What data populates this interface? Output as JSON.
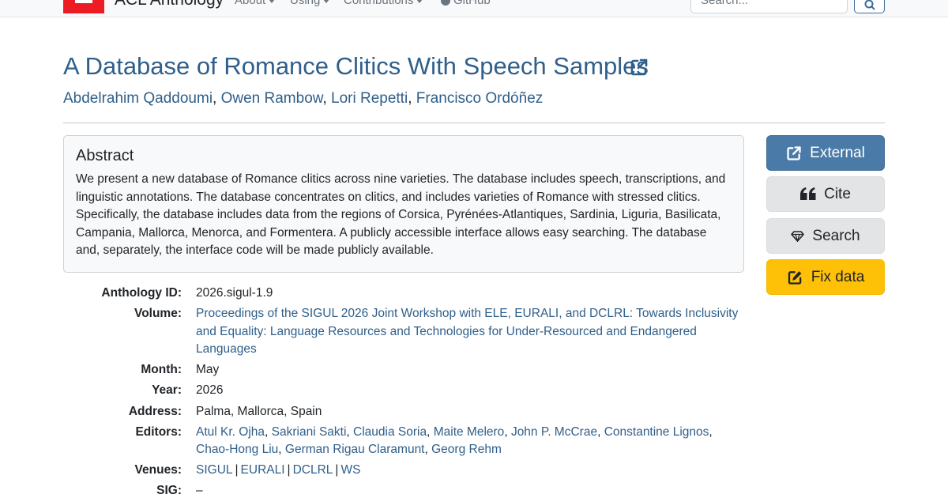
{
  "navbar": {
    "brand": "ACL Anthology",
    "links": [
      {
        "label": "About"
      },
      {
        "label": "Using"
      },
      {
        "label": "Contributions"
      },
      {
        "label": "GitHub"
      }
    ],
    "search_placeholder": "Search..."
  },
  "paper": {
    "title": "A Database of Romance Clitics With Speech Samples",
    "authors": [
      "Abdelrahim Qaddoumi",
      "Owen Rambow",
      "Lori Repetti",
      "Francisco Ordóñez"
    ],
    "abstract_heading": "Abstract",
    "abstract_text": "We present a new database of Romance clitics across nine varieties. The database includes speech, transcriptions, and linguistic annotations. The database concentrates on clitics, and includes varieties of Romance with stressed clitics. Specifically, the database includes data from the regions of Corsica, Pyrénées-Atlantiques, Sardinia, Liguria, Basilicata, Campania, Mallorca, Menorca, and Formentera. A publicly accessible interface allows easy searching. The database and, separately, the interface code will be made publicly available."
  },
  "details": {
    "anthology_id_label": "Anthology ID:",
    "anthology_id": "2026.sigul-1.9",
    "volume_label": "Volume:",
    "volume": "Proceedings of the SIGUL 2026 Joint Workshop with ELE, EURALI, and DCLRL: Towards Inclusivity and Equality: Language Resources and Technologies for Under-Resourced and Endangered Languages",
    "month_label": "Month:",
    "month": "May",
    "year_label": "Year:",
    "year": "2026",
    "address_label": "Address:",
    "address": "Palma, Mallorca, Spain",
    "editors_label": "Editors:",
    "editors": [
      "Atul Kr. Ojha",
      "Sakriani Sakti",
      "Claudia Soria",
      "Maite Melero",
      "John P. McCrae",
      "Constantine Lignos",
      "Chao-Hong Liu",
      "German Rigau Claramunt",
      "Georg Rehm"
    ],
    "venues_label": "Venues:",
    "venues": [
      "SIGUL",
      "EURALI",
      "DCLRL",
      "WS"
    ],
    "sig_label": "SIG:",
    "sig": "–"
  },
  "sidebar": {
    "external_label": "External",
    "cite_label": "Cite",
    "search_label": "Search",
    "fix_label": "Fix data"
  },
  "colors": {
    "link": "#2f5f8a",
    "primary_button": "#4a7aa7",
    "warning_button": "#ffc107",
    "logo_red": "#ed1c24"
  },
  "icons": [
    "external-link-icon",
    "quote-icon",
    "search-icon",
    "edit-icon",
    "github-icon",
    "caret-down-icon"
  ]
}
